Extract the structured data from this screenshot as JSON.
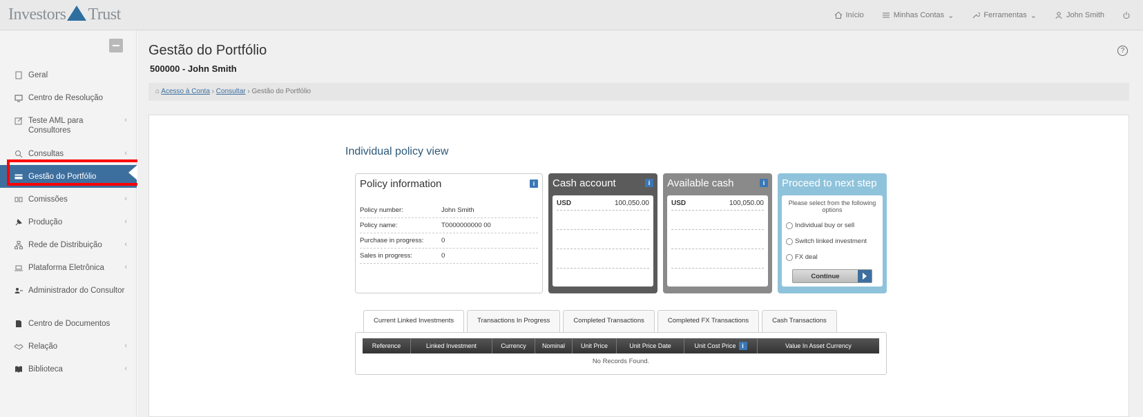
{
  "brand": {
    "name_part1": "Investors",
    "name_part2": "Trust"
  },
  "topnav": {
    "home": "Início",
    "accounts": "Minhas Contas",
    "tools": "Ferramentas",
    "user": "John Smith"
  },
  "sidebar": {
    "items": [
      {
        "label": "Geral",
        "chevron": ""
      },
      {
        "label": "Centro de Resolução",
        "chevron": ""
      },
      {
        "label": "Teste AML para Consultores",
        "chevron": "‹"
      },
      {
        "label": "Consultas",
        "chevron": "‹"
      },
      {
        "label": "Gestão do Portfólio",
        "chevron": ""
      },
      {
        "label": "Comissões",
        "chevron": "‹"
      },
      {
        "label": "Produção",
        "chevron": "‹"
      },
      {
        "label": "Rede de Distribuição",
        "chevron": "‹"
      },
      {
        "label": "Plataforma Eletrônica",
        "chevron": "‹"
      },
      {
        "label": "Administrador do Consultor",
        "chevron": ""
      },
      {
        "label": "Centro de Documentos",
        "chevron": ""
      },
      {
        "label": "Relação",
        "chevron": "‹"
      },
      {
        "label": "Biblioteca",
        "chevron": "‹"
      }
    ]
  },
  "page": {
    "title": "Gestão do Portfólio",
    "subtitle": "500000 - John Smith",
    "help": "?"
  },
  "breadcrumb": {
    "home": "Acesso à Conta",
    "sep": "›",
    "consult": "Consultar",
    "current": "Gestão do Portfólio"
  },
  "ipv": {
    "title": "Individual policy view",
    "policy": {
      "header": "Policy information",
      "rows": [
        {
          "label": "Policy number:",
          "value": "John Smith"
        },
        {
          "label": "Policy name:",
          "value": "T0000000000 00"
        },
        {
          "label": "Purchase in progress:",
          "value": "0"
        },
        {
          "label": "Sales in progress:",
          "value": "0"
        }
      ]
    },
    "cash": {
      "header": "Cash account",
      "currency": "USD",
      "amount": "100,050.00"
    },
    "available": {
      "header": "Available cash",
      "currency": "USD",
      "amount": "100,050.00"
    },
    "proceed": {
      "header": "Proceed to next step",
      "prompt": "Please select from the following options",
      "options": [
        "Individual buy or sell",
        "Switch linked investment",
        "FX deal"
      ],
      "button": "Continue"
    },
    "info_glyph": "i"
  },
  "tabs": [
    "Current Linked Investments",
    "Transactions In Progress",
    "Completed Transactions",
    "Completed FX Transactions",
    "Cash Transactions"
  ],
  "grid": {
    "columns": [
      "Reference",
      "Linked Investment",
      "Currency",
      "Nominal",
      "Unit Price",
      "Unit Price Date",
      "Unit Cost Price",
      "Value In Asset Currency"
    ],
    "empty": "No Records Found."
  }
}
